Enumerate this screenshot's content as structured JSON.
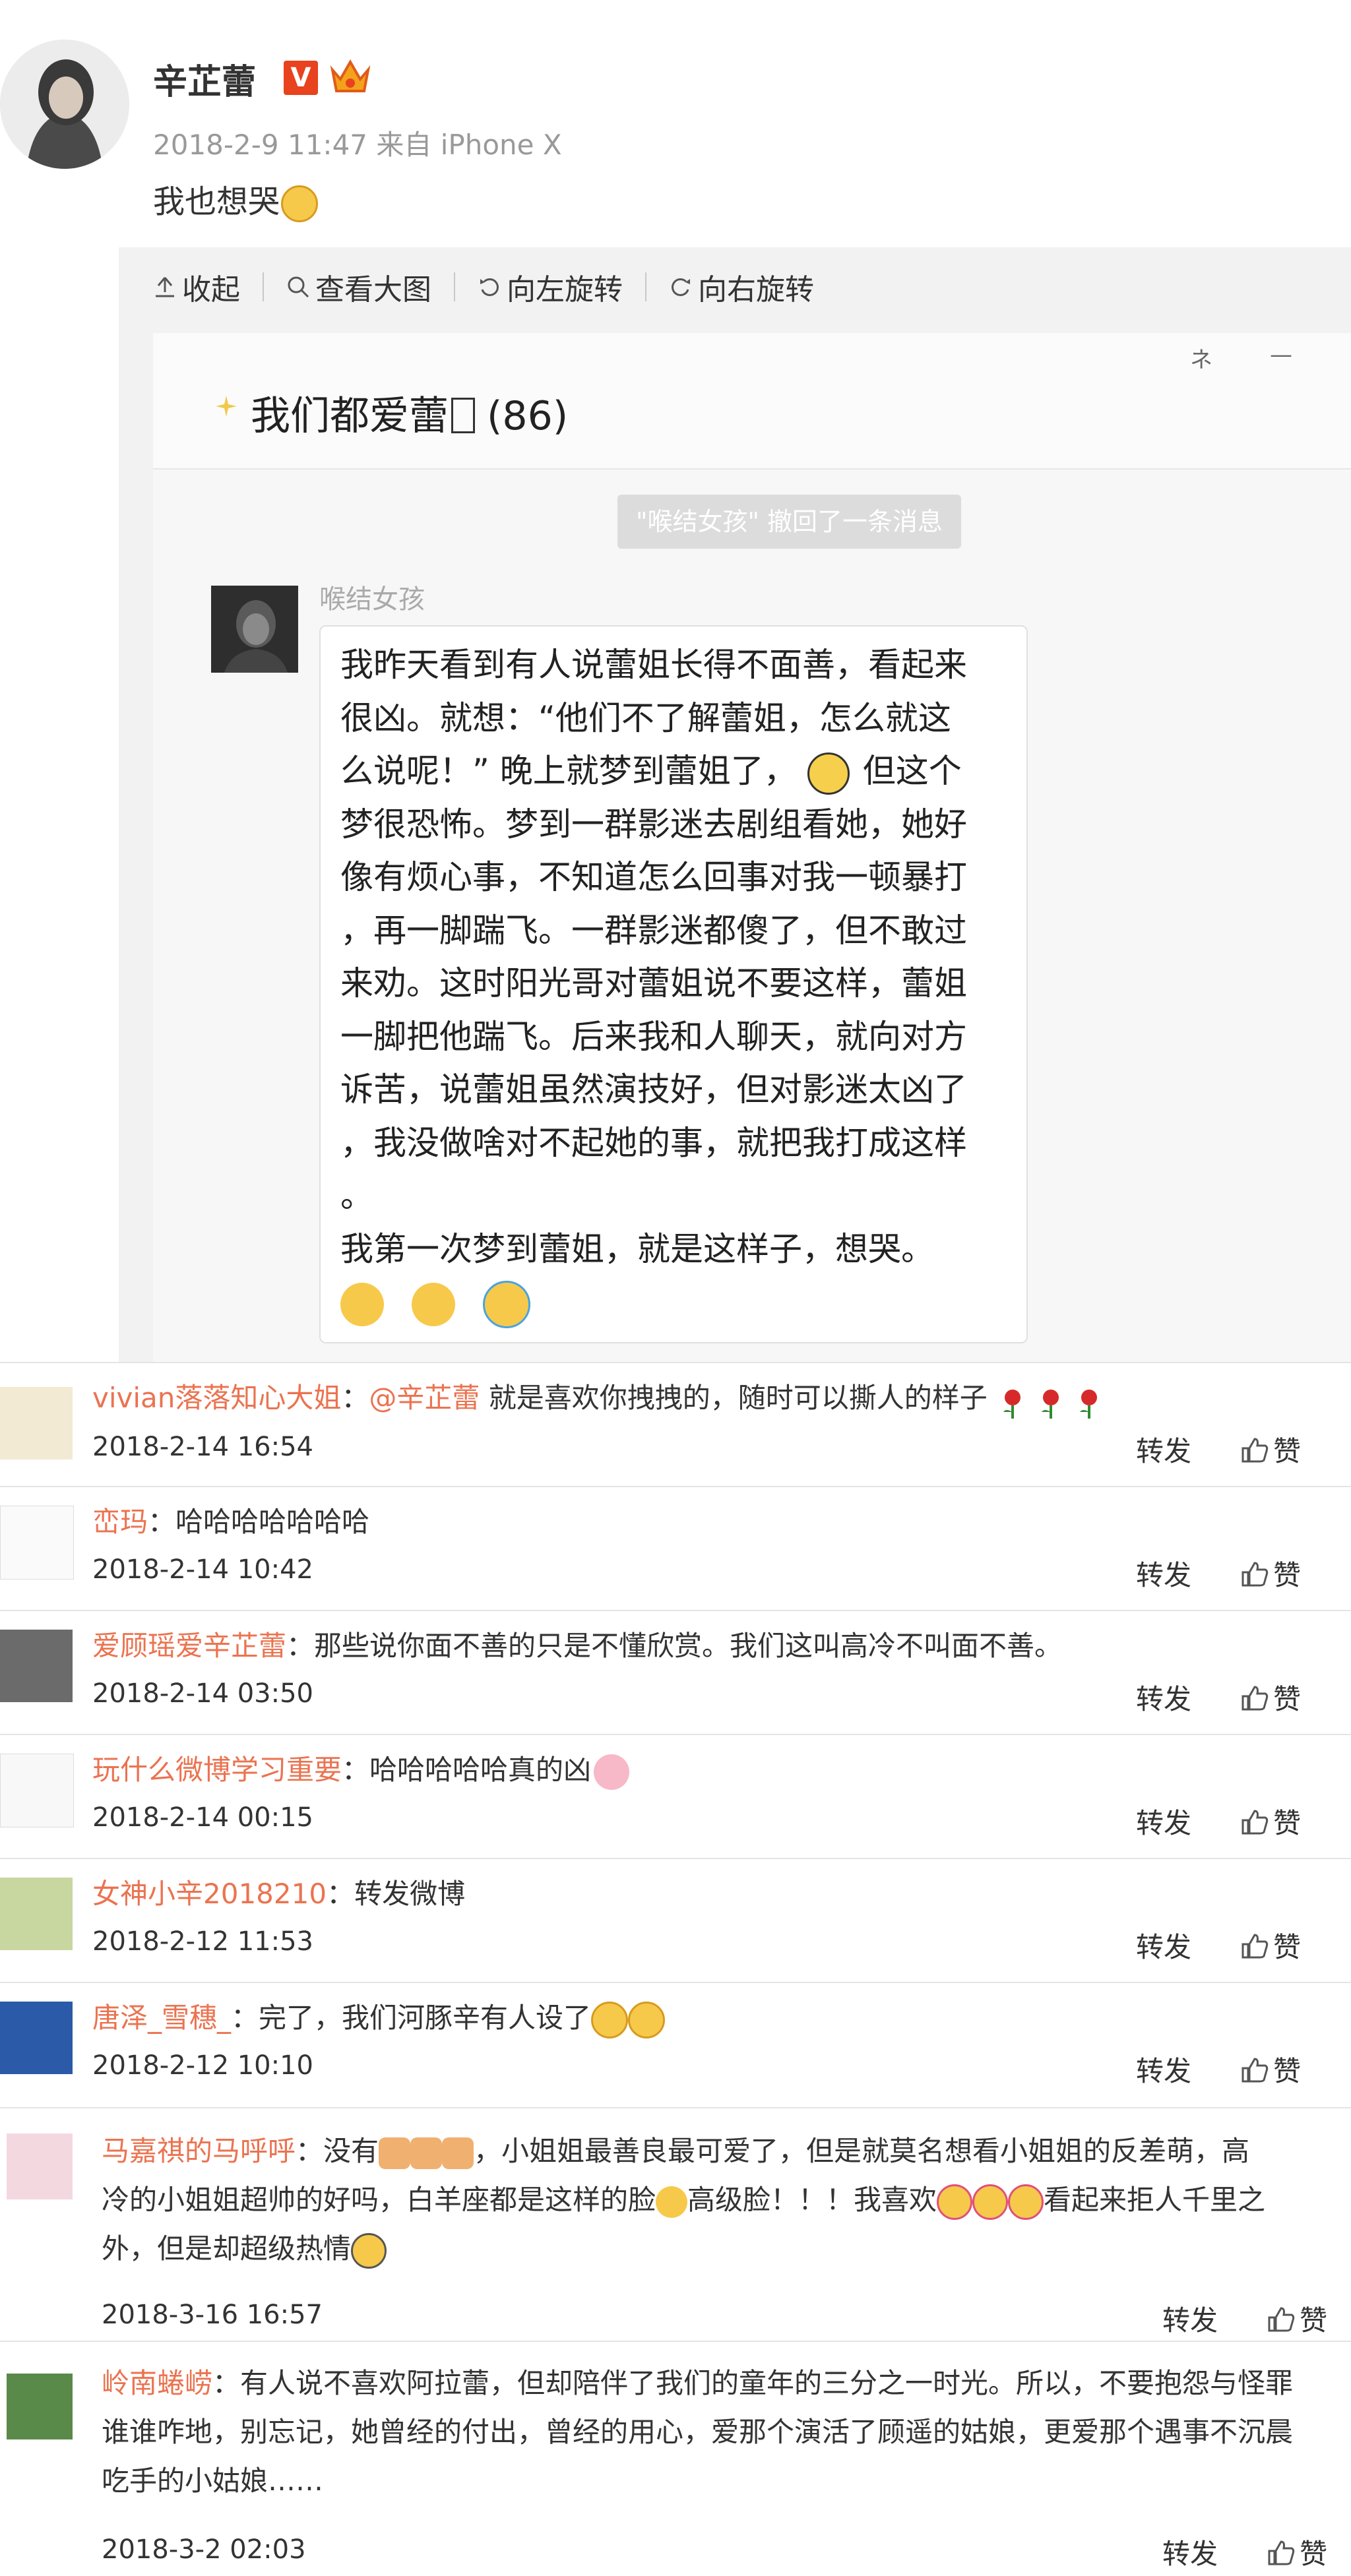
{
  "post": {
    "author": "辛芷蕾",
    "verified_badge": "V",
    "meta": "2018-2-9 11:47 来自 iPhone X",
    "text": "我也想哭"
  },
  "toolbar": {
    "collapse": "收起",
    "view_large": "查看大图",
    "rotate_left": "向左旋转",
    "rotate_right": "向右旋转"
  },
  "chat": {
    "title": "我们都爱蕾",
    "count": "(86)",
    "window_controls": [
      "ネ",
      "—"
    ],
    "recall_notice": "\"喉结女孩\" 撤回了一条消息",
    "sender": "喉结女孩",
    "message_lines": [
      "我昨天看到有人说蕾姐长得不面善，看起来",
      "很凶。就想：“他们不了解蕾姐，怎么就这",
      "么说呢！” 晚上就梦到蕾姐了，",
      "梦很恐怖。梦到一群影迷去剧组看她，她好",
      "像有烦心事，不知道怎么回事对我一顿暴打",
      "，再一脚踹飞。一群影迷都傻了，但不敢过",
      "来劝。这时阳光哥对蕾姐说不要这样，蕾姐",
      "一脚把他踹飞。后来我和人聊天，就向对方",
      "诉苦，说蕾姐虽然演技好，但对影迷太凶了",
      "，我没做啥对不起她的事，就把我打成这样",
      "。",
      "我第一次梦到蕾姐，就是这样子，想哭。"
    ],
    "line3_tail": "但这个"
  },
  "comments": [
    {
      "user": "vivian落落知心大姐",
      "mention": "@辛芷蕾",
      "text": " 就是喜欢你拽拽的，随时可以撕人的样子",
      "date": "2018-2-14 16:54",
      "forward": "转发",
      "like": "赞"
    },
    {
      "user": "峦玛",
      "text": "：哈哈哈哈哈哈哈",
      "date": "2018-2-14 10:42",
      "forward": "转发",
      "like": "赞"
    },
    {
      "user": "爱顾瑶爱辛芷蕾",
      "text": "：那些说你面不善的只是不懂欣赏。我们这叫高冷不叫面不善。",
      "date": "2018-2-14 03:50",
      "forward": "转发",
      "like": "赞"
    },
    {
      "user": "玩什么微博学习重要",
      "text": "：哈哈哈哈哈真的凶",
      "date": "2018-2-14 00:15",
      "forward": "转发",
      "like": "赞"
    },
    {
      "user": "女神小辛2018210",
      "text": "：转发微博",
      "date": "2018-2-12 11:53",
      "forward": "转发",
      "like": "赞"
    },
    {
      "user": "唐泽_雪穗_",
      "text": "：完了，我们河豚辛有人设了",
      "date": "2018-2-12 10:10",
      "forward": "转发",
      "like": "赞"
    },
    {
      "user": "马嘉祺的马呼呼",
      "line1a": "：没有",
      "line1b": "，小姐姐最善良最可爱了，但是就莫名想看小姐姐的反差萌，高",
      "line2a": "冷的小姐姐超帅的好吗，白羊座都是这样的脸",
      "line2b": "高级脸！！！我喜欢",
      "line2c": "看起来拒人千里之",
      "line3": "外，但是却超级热情",
      "date": "2018-3-16 16:57",
      "forward": "转发",
      "like": "赞"
    },
    {
      "user": "岭南蜷崂",
      "line1": "：有人说不喜欢阿拉蕾，但却陪伴了我们的童年的三分之一时光。所以，不要抱怨与怪罪",
      "line2": "谁谁咋地，别忘记，她曾经的付出，曾经的用心，爱那个演活了顾遥的姑娘，更爱那个遇事不沉晨",
      "line3": "吃手的小姑娘……",
      "date": "2018-3-2 02:03",
      "forward": "转发",
      "like": "赞"
    }
  ]
}
